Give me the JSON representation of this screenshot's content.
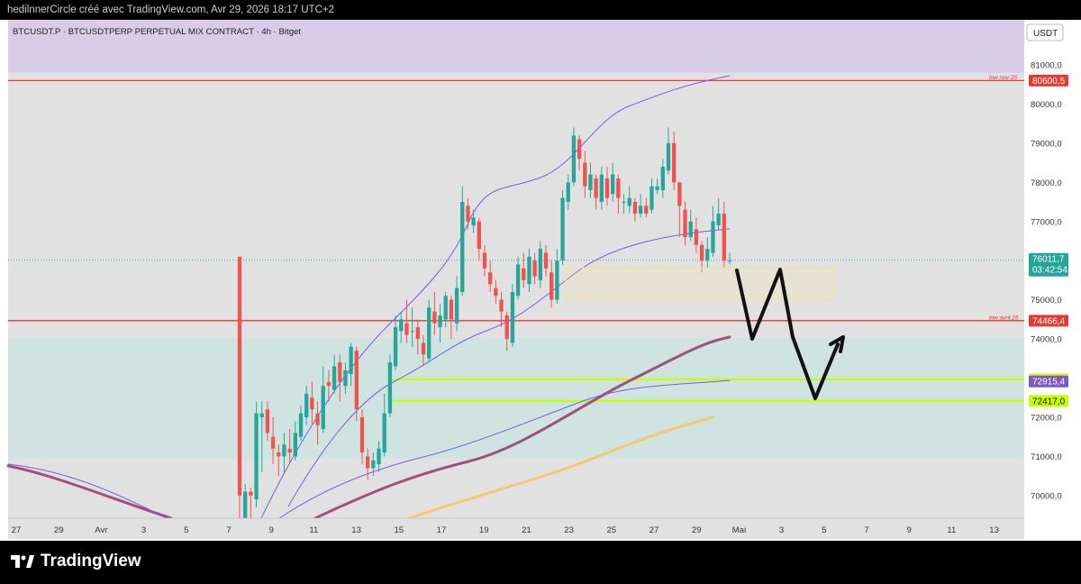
{
  "header": {
    "text": "hedilnnerCircle créé avec TradingView.com, Avr 29, 2026 18:17 UTC+2"
  },
  "footer": {
    "brand": "TradingView"
  },
  "chart_data": {
    "type": "candlestick",
    "title": "BTCUSDT.P · BTCUSDTPERP PERPETUAL MIX CONTRACT · 4h · Bitget",
    "currency_button": "USDT",
    "y_axis": {
      "ticks": [
        "81000,0",
        "80000,0",
        "79000,0",
        "78000,0",
        "77000,0",
        "75000,0",
        "74000,0",
        "72000,0",
        "71000,0",
        "70000,0"
      ],
      "tick_values": [
        81000,
        80000,
        79000,
        78000,
        77000,
        75000,
        74000,
        72000,
        71000,
        70000
      ],
      "range": [
        69400,
        82500
      ]
    },
    "x_axis": {
      "ticks": [
        "27",
        "29",
        "Avr",
        "3",
        "5",
        "7",
        "9",
        "11",
        "13",
        "15",
        "17",
        "19",
        "21",
        "23",
        "25",
        "27",
        "29",
        "Mai",
        "3",
        "5",
        "7",
        "9",
        "11",
        "13"
      ]
    },
    "price_labels": [
      {
        "text": "80600,5",
        "value": 80600.5,
        "color": "#e53935"
      },
      {
        "text": "76011,7",
        "sub": "03:42:54",
        "value": 76011.7,
        "color": "#26a69a"
      },
      {
        "text": "74466,4",
        "value": 74466.4,
        "color": "#e53935"
      },
      {
        "text": "72965,2",
        "value": 72965.2,
        "color": "#c6ff00",
        "text_color": "#111111"
      },
      {
        "text": "72915,4",
        "value": 72915.4,
        "color": "#7e57c2"
      },
      {
        "text": "72417,0",
        "value": 72417.0,
        "color": "#c6ff00",
        "text_color": "#111111"
      }
    ],
    "horizontal_lines": [
      {
        "value": 80600.5,
        "label": "low nov 25",
        "color": "#e53935"
      },
      {
        "value": 74466.4,
        "label": "low avril 25",
        "color": "#e53935"
      },
      {
        "value": 72965.2,
        "color": "#c6ff00"
      },
      {
        "value": 72417.0,
        "color": "#c6ff00"
      }
    ],
    "zones": [
      {
        "from": 80800,
        "to": 82500,
        "color": "#d8cce8"
      },
      {
        "from": 70950,
        "to": 74020,
        "color": "#cfe3e0"
      }
    ],
    "current_price": 76011.7,
    "colors": {
      "up": "#26a69a",
      "down": "#ef5350",
      "bb": "#7b5ce0",
      "ema_mid": "#a0507a",
      "ema_slow": "#f5c870",
      "chart_bg": "#e1e1e1"
    },
    "candles": [
      [
        76.1,
        70.0,
        70.2,
        69.1,
        69.3
      ],
      [
        69.3,
        70.1,
        70.3,
        69.4,
        70.1
      ],
      [
        70.1,
        70.0,
        70.2,
        69.3,
        69.9
      ],
      [
        69.9,
        72.1,
        72.4,
        69.7,
        72.0
      ],
      [
        72.0,
        72.1,
        72.4,
        70.6,
        72.2
      ],
      [
        72.2,
        71.6,
        72.4,
        71.4,
        71.5
      ],
      [
        71.5,
        71.2,
        72.0,
        70.8,
        71.1
      ],
      [
        71.1,
        71.0,
        71.3,
        70.5,
        71.0
      ],
      [
        71.0,
        71.3,
        71.6,
        70.6,
        71.2
      ],
      [
        71.2,
        71.1,
        71.7,
        70.8,
        71.0
      ],
      [
        71.0,
        71.6,
        71.9,
        70.9,
        71.5
      ],
      [
        71.5,
        72.1,
        72.3,
        71.4,
        72.0
      ],
      [
        72.0,
        72.6,
        72.8,
        71.8,
        72.5
      ],
      [
        72.5,
        72.2,
        72.9,
        71.8,
        72.1
      ],
      [
        72.1,
        71.8,
        72.4,
        71.3,
        71.7
      ],
      [
        71.7,
        72.8,
        73.3,
        71.6,
        72.9
      ],
      [
        72.9,
        72.8,
        73.2,
        72.4,
        72.7
      ],
      [
        72.7,
        73.3,
        73.6,
        72.6,
        73.4
      ],
      [
        73.4,
        72.9,
        73.6,
        72.4,
        72.8
      ],
      [
        72.8,
        73.2,
        73.4,
        72.6,
        73.1
      ],
      [
        73.1,
        73.8,
        73.9,
        72.8,
        73.7
      ],
      [
        73.7,
        72.2,
        73.8,
        71.9,
        72.0
      ],
      [
        72.0,
        71.1,
        72.2,
        70.8,
        71.0
      ],
      [
        71.0,
        70.7,
        71.2,
        70.4,
        70.7
      ],
      [
        70.7,
        70.9,
        71.1,
        70.5,
        70.8
      ],
      [
        70.8,
        71.2,
        71.4,
        70.6,
        71.1
      ],
      [
        71.1,
        72.1,
        72.6,
        71.0,
        72.1
      ],
      [
        72.1,
        73.4,
        73.6,
        72.0,
        73.3
      ],
      [
        73.3,
        74.3,
        74.6,
        73.2,
        74.2
      ],
      [
        74.2,
        74.5,
        74.7,
        73.9,
        74.4
      ],
      [
        74.4,
        74.1,
        75.0,
        73.9,
        74.2
      ],
      [
        74.2,
        74.2,
        74.8,
        73.8,
        74.3
      ],
      [
        74.3,
        74.0,
        74.5,
        73.6,
        73.9
      ],
      [
        73.9,
        73.6,
        74.1,
        73.3,
        73.5
      ],
      [
        73.5,
        74.8,
        75.0,
        73.4,
        74.7
      ],
      [
        74.7,
        74.4,
        75.2,
        74.1,
        74.3
      ],
      [
        74.3,
        74.6,
        74.9,
        73.9,
        74.5
      ],
      [
        74.5,
        75.1,
        75.2,
        74.3,
        75.0
      ],
      [
        75.0,
        74.5,
        75.1,
        74.0,
        74.4
      ],
      [
        74.4,
        75.3,
        75.6,
        74.2,
        75.2
      ],
      [
        75.2,
        77.5,
        77.9,
        75.1,
        77.4
      ],
      [
        77.4,
        77.0,
        77.6,
        76.8,
        76.9
      ],
      [
        76.9,
        77.1,
        77.3,
        76.7,
        77.0
      ],
      [
        77.0,
        76.3,
        77.1,
        76.0,
        76.2
      ],
      [
        76.2,
        75.8,
        76.4,
        75.6,
        75.7
      ],
      [
        75.7,
        75.4,
        76.0,
        75.2,
        75.3
      ],
      [
        75.3,
        75.1,
        75.5,
        74.9,
        75.0
      ],
      [
        75.0,
        74.7,
        75.2,
        74.3,
        74.6
      ],
      [
        74.6,
        74.0,
        74.7,
        73.7,
        73.9
      ],
      [
        73.9,
        75.2,
        75.4,
        73.8,
        75.1
      ],
      [
        75.1,
        75.9,
        76.1,
        75.0,
        75.8
      ],
      [
        75.8,
        75.5,
        76.2,
        75.3,
        75.4
      ],
      [
        75.4,
        76.1,
        76.3,
        75.2,
        76.0
      ],
      [
        76.0,
        75.6,
        76.2,
        75.4,
        75.5
      ],
      [
        75.5,
        76.3,
        76.5,
        75.3,
        76.2
      ],
      [
        76.2,
        75.8,
        76.4,
        75.6,
        75.7
      ],
      [
        75.7,
        75.0,
        76.0,
        74.8,
        75.0
      ],
      [
        75.0,
        76.0,
        76.3,
        74.9,
        76.0
      ],
      [
        76.0,
        77.6,
        77.8,
        75.9,
        77.5
      ],
      [
        77.5,
        78.0,
        78.2,
        77.3,
        78.0
      ],
      [
        78.0,
        79.2,
        79.4,
        77.9,
        79.1
      ],
      [
        79.1,
        78.6,
        79.2,
        78.3,
        78.5
      ],
      [
        78.5,
        77.9,
        78.8,
        77.6,
        77.8
      ],
      [
        77.8,
        78.2,
        78.5,
        77.6,
        78.1
      ],
      [
        78.1,
        77.6,
        78.2,
        77.3,
        77.5
      ],
      [
        77.5,
        78.2,
        78.4,
        77.3,
        78.1
      ],
      [
        78.1,
        77.6,
        78.4,
        77.4,
        77.7
      ],
      [
        77.7,
        78.2,
        78.5,
        77.5,
        78.1
      ],
      [
        78.1,
        77.6,
        78.2,
        77.2,
        77.5
      ],
      [
        77.5,
        77.5,
        77.7,
        77.2,
        77.4
      ],
      [
        77.4,
        77.6,
        77.9,
        77.2,
        77.5
      ],
      [
        77.5,
        77.2,
        77.6,
        77.0,
        77.2
      ],
      [
        77.2,
        77.4,
        77.7,
        77.1,
        77.4
      ],
      [
        77.4,
        77.2,
        77.6,
        77.1,
        77.3
      ],
      [
        77.3,
        77.9,
        78.1,
        77.2,
        77.8
      ],
      [
        77.8,
        77.9,
        78.1,
        77.7,
        77.8
      ],
      [
        77.8,
        78.4,
        78.6,
        77.6,
        78.3
      ],
      [
        78.3,
        79.0,
        79.4,
        78.2,
        79.0
      ],
      [
        79.0,
        78.0,
        79.3,
        77.8,
        78.0
      ],
      [
        78.0,
        77.4,
        78.0,
        76.6,
        77.3
      ],
      [
        77.3,
        76.6,
        77.5,
        76.4,
        76.6
      ],
      [
        76.6,
        77.0,
        77.3,
        76.5,
        76.8
      ],
      [
        76.8,
        76.4,
        77.1,
        76.2,
        76.4
      ],
      [
        76.4,
        76.0,
        76.5,
        75.7,
        76.0
      ],
      [
        76.0,
        76.3,
        76.6,
        75.8,
        76.2
      ],
      [
        76.2,
        77.0,
        77.4,
        76.1,
        76.9
      ],
      [
        76.9,
        77.2,
        77.6,
        76.8,
        77.2
      ],
      [
        77.2,
        76.0,
        77.5,
        75.8,
        76.0
      ],
      [
        76.0,
        76.0,
        76.2,
        75.9,
        76.0
      ]
    ]
  }
}
